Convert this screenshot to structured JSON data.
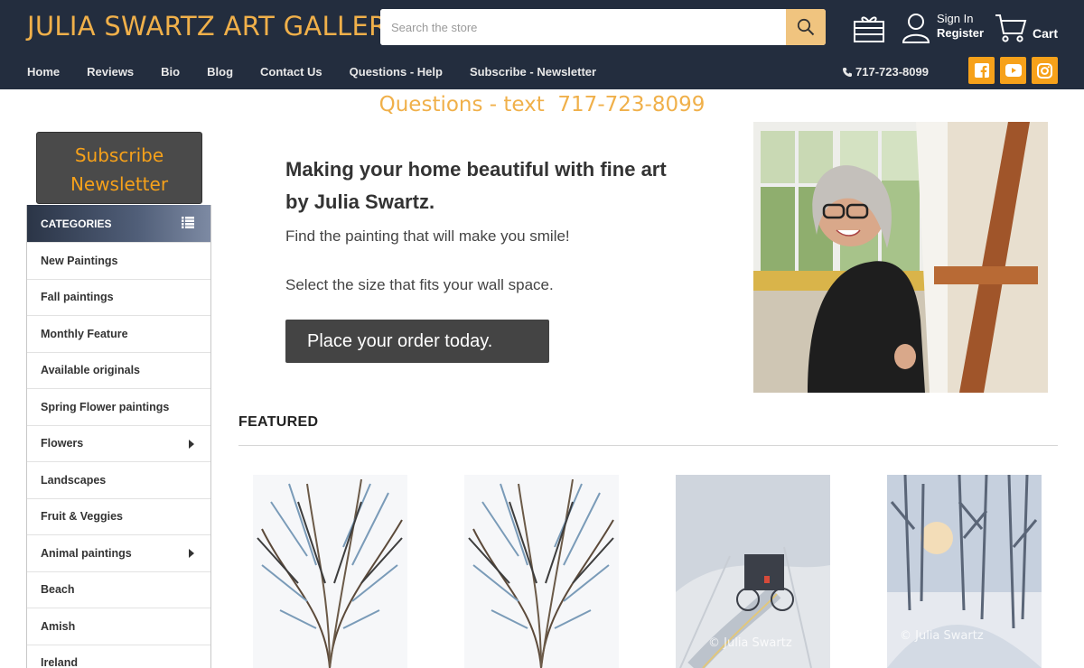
{
  "header": {
    "logo": "JULIA SWARTZ ART GALLERY",
    "search_placeholder": "Search the store",
    "sign_in": "Sign In",
    "register": "Register",
    "cart": "Cart",
    "phone": "717-723-8099",
    "colors": {
      "header_bg": "#232d3e",
      "accent": "#f0b04a",
      "social_bg": "#f6a11a"
    }
  },
  "nav": {
    "items": [
      "Home",
      "Reviews",
      "Bio",
      "Blog",
      "Contact Us",
      "Questions - Help",
      "Subscribe - Newsletter"
    ]
  },
  "social": [
    "facebook-icon",
    "youtube-icon",
    "instagram-icon"
  ],
  "tagline": "Questions - text  717-723-8099",
  "sidebar": {
    "subscribe_line1": "Subscribe",
    "subscribe_line2": "Newsletter",
    "categories_title": "CATEGORIES",
    "categories": [
      {
        "label": "New Paintings",
        "has_sub": false
      },
      {
        "label": "Fall paintings",
        "has_sub": false
      },
      {
        "label": "Monthly Feature",
        "has_sub": false
      },
      {
        "label": "Available originals",
        "has_sub": false
      },
      {
        "label": "Spring Flower paintings",
        "has_sub": false
      },
      {
        "label": "Flowers",
        "has_sub": true
      },
      {
        "label": "Landscapes",
        "has_sub": false
      },
      {
        "label": "Fruit & Veggies",
        "has_sub": false
      },
      {
        "label": "Animal paintings",
        "has_sub": true
      },
      {
        "label": "Beach",
        "has_sub": false
      },
      {
        "label": "Amish",
        "has_sub": false
      },
      {
        "label": "Ireland",
        "has_sub": false
      }
    ]
  },
  "hero": {
    "title": "Making your home beautiful with fine art by Julia Swartz.",
    "line1": "Find the painting that will make you smile!",
    "line2": "Select the size that fits your wall space.",
    "cta": "Place your order today."
  },
  "featured": {
    "title": "FEATURED",
    "products": [
      {
        "watermark": ""
      },
      {
        "watermark": ""
      },
      {
        "watermark": "© Julia Swartz"
      },
      {
        "watermark": "© Julia Swartz"
      }
    ]
  }
}
